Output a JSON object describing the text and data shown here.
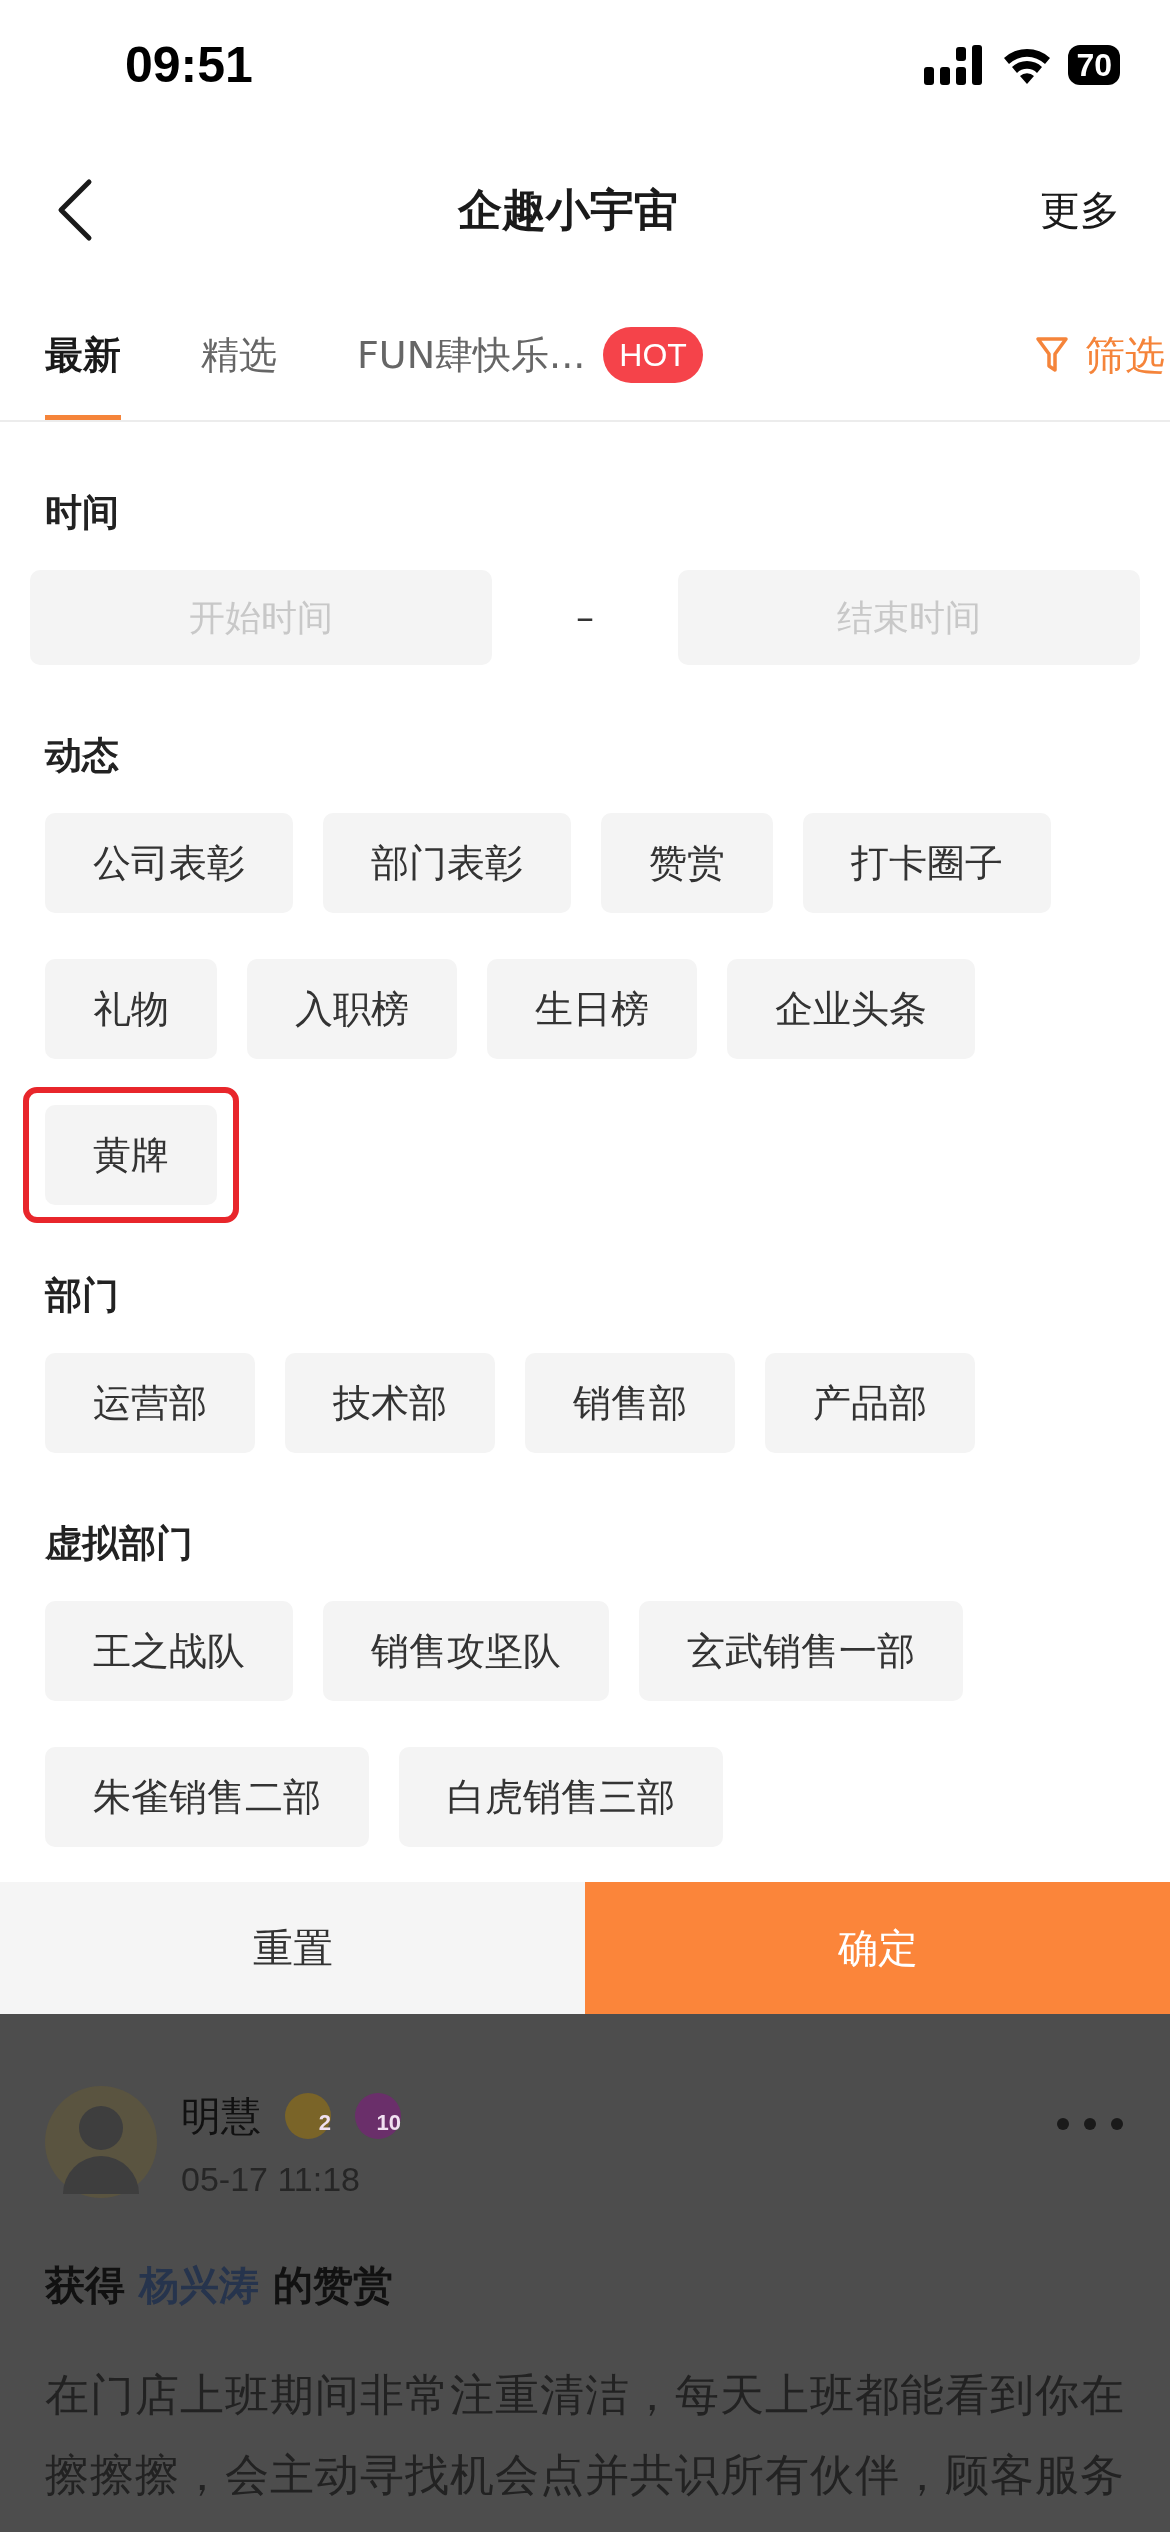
{
  "status_bar": {
    "time": "09:51",
    "battery": "70"
  },
  "nav": {
    "title": "企趣小宇宙",
    "more": "更多"
  },
  "tabs": [
    {
      "label": "最新",
      "selected": true
    },
    {
      "label": "精选",
      "selected": false
    },
    {
      "label": "FUN肆快乐...",
      "selected": false,
      "badge": "HOT"
    }
  ],
  "filter_button": "筛选",
  "filter_panel": {
    "sections": [
      {
        "kind": "dates",
        "title": "时间",
        "start_placeholder": "开始时间",
        "separator": "–",
        "end_placeholder": "结束时间"
      },
      {
        "kind": "chips",
        "title": "动态",
        "chips": [
          {
            "label": "公司表彰",
            "highlighted": false
          },
          {
            "label": "部门表彰",
            "highlighted": false
          },
          {
            "label": "赞赏",
            "highlighted": false
          },
          {
            "label": "打卡圈子",
            "highlighted": false
          },
          {
            "label": "礼物",
            "highlighted": false
          },
          {
            "label": "入职榜",
            "highlighted": false
          },
          {
            "label": "生日榜",
            "highlighted": false
          },
          {
            "label": "企业头条",
            "highlighted": false
          },
          {
            "label": "黄牌",
            "highlighted": true
          }
        ]
      },
      {
        "kind": "chips",
        "title": "部门",
        "chips": [
          {
            "label": "运营部",
            "highlighted": false
          },
          {
            "label": "技术部",
            "highlighted": false
          },
          {
            "label": "销售部",
            "highlighted": false
          },
          {
            "label": "产品部",
            "highlighted": false
          }
        ]
      },
      {
        "kind": "chips",
        "title": "虚拟部门",
        "chips": [
          {
            "label": "王之战队",
            "highlighted": false
          },
          {
            "label": "销售攻坚队",
            "highlighted": false
          },
          {
            "label": "玄武销售一部",
            "highlighted": false
          },
          {
            "label": "朱雀销售二部",
            "highlighted": false
          },
          {
            "label": "白虎销售三部",
            "highlighted": false
          }
        ]
      }
    ],
    "reset_button": "重置",
    "confirm_button": "确定"
  },
  "post": {
    "author": "明慧",
    "badges": [
      "2",
      "10"
    ],
    "time": "05-17 11:18",
    "title_prefix": "获得",
    "mention": "杨兴涛",
    "title_suffix": "的赞赏",
    "body": "在门店上班期间非常注重清洁，每天上班都能看到你在擦擦擦，会主动寻找机会点并共识所有伙伴，顾客服务"
  }
}
